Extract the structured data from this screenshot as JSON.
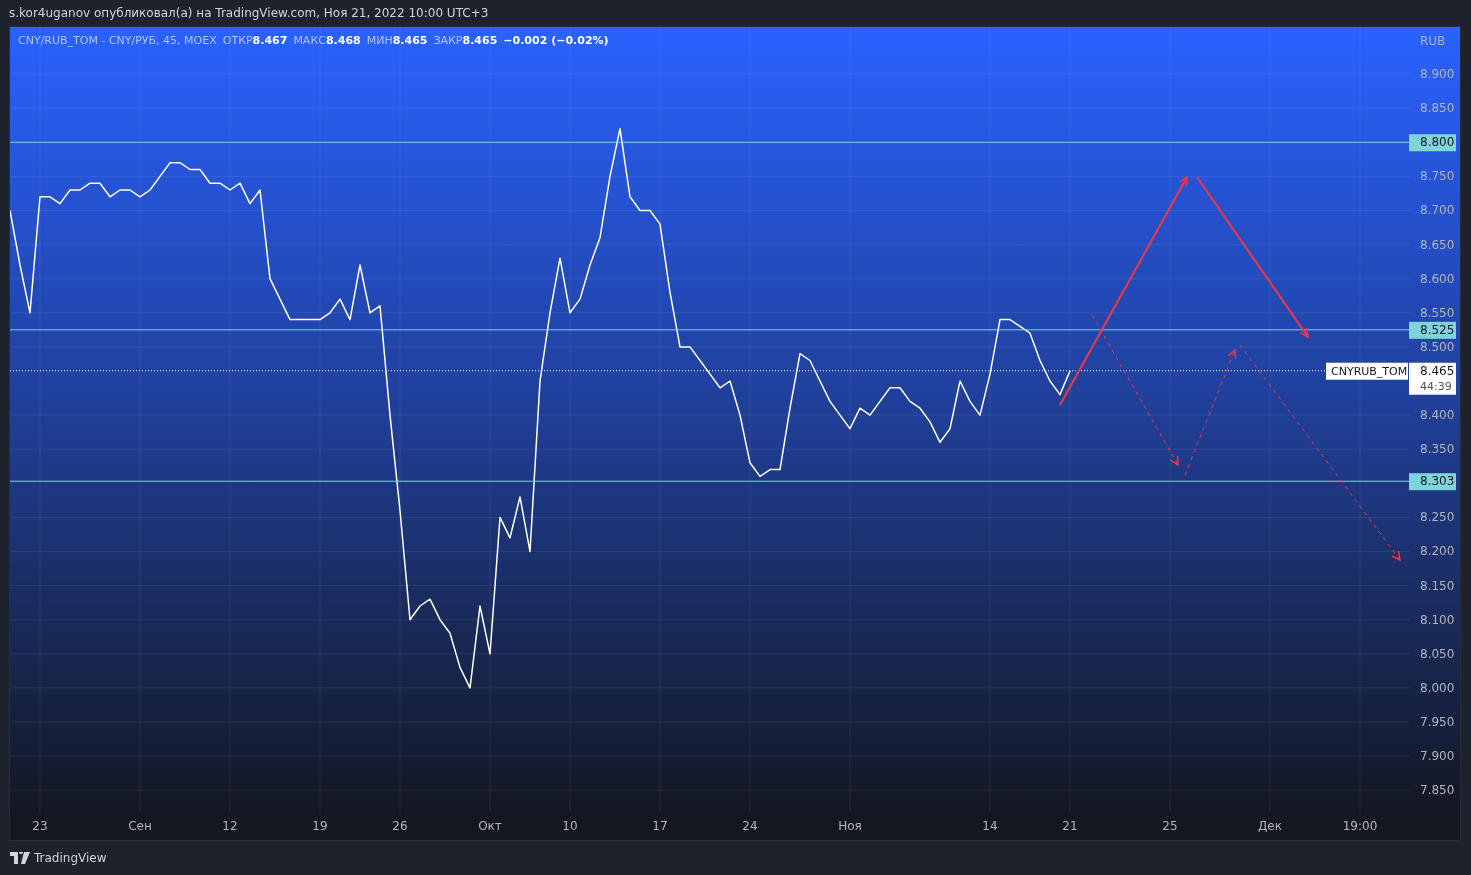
{
  "header": {
    "text": "s.kor4uganov опубликовал(а) на TradingView.com, Ноя 21, 2022 10:00 UTC+3"
  },
  "legend": {
    "symbol": "CNY/RUB_TOM - CNY/РУБ, 45, MOEX",
    "fields": [
      {
        "label": "ОТКР",
        "value": "8.467"
      },
      {
        "label": "МАКС",
        "value": "8.468"
      },
      {
        "label": "МИН",
        "value": "8.465"
      },
      {
        "label": "ЗАКР",
        "value": "8.465"
      }
    ],
    "change": "−0.002 (−0.02%)"
  },
  "chart": {
    "chart_data": {
      "type": "line",
      "ylabel": "RUB",
      "ylim": [
        7.818,
        8.969
      ],
      "categories": [
        null,
        null,
        null,
        "23",
        null,
        null,
        null,
        null,
        null,
        null,
        null,
        null,
        null,
        "Сен",
        null,
        null,
        null,
        null,
        null,
        null,
        null,
        null,
        "12",
        null,
        null,
        null,
        null,
        null,
        null,
        null,
        null,
        "19",
        null,
        null,
        null,
        null,
        null,
        null,
        null,
        "26",
        null,
        null,
        null,
        null,
        null,
        null,
        null,
        null,
        "Окт",
        null,
        null,
        null,
        null,
        null,
        null,
        null,
        "10",
        null,
        null,
        null,
        null,
        null,
        null,
        null,
        null,
        "17",
        null,
        null,
        null,
        null,
        null,
        null,
        null,
        null,
        "24",
        null,
        null,
        null,
        null,
        null,
        null,
        null,
        null,
        null,
        "Ноя",
        null,
        null,
        null,
        null,
        null,
        null,
        null,
        null,
        null,
        null,
        null,
        null,
        null,
        "14",
        null,
        null,
        null,
        null,
        null,
        null,
        null,
        "21",
        null,
        null,
        null,
        null,
        null,
        null,
        null,
        null,
        null,
        "25",
        null,
        null,
        null,
        null,
        null,
        null,
        null,
        null,
        null,
        "Дек",
        null,
        null,
        null,
        null,
        null,
        null,
        null,
        null,
        "19:00",
        null,
        null,
        null,
        null,
        null
      ],
      "series": [
        {
          "name": "CNYRUB_TOM",
          "color": "#ffffff",
          "values": [
            8.7,
            8.62,
            8.55,
            8.72,
            8.72,
            8.71,
            8.73,
            8.73,
            8.74,
            8.74,
            8.72,
            8.73,
            8.73,
            8.72,
            8.73,
            8.75,
            8.77,
            8.77,
            8.76,
            8.76,
            8.74,
            8.74,
            8.73,
            8.74,
            8.71,
            8.73,
            8.6,
            8.57,
            8.54,
            8.54,
            8.54,
            8.54,
            8.55,
            8.57,
            8.54,
            8.62,
            8.55,
            8.56,
            8.4,
            8.26,
            8.1,
            8.12,
            8.13,
            8.1,
            8.08,
            8.03,
            8.0,
            8.12,
            8.05,
            8.25,
            8.22,
            8.28,
            8.2,
            8.45,
            8.55,
            8.63,
            8.55,
            8.57,
            8.62,
            8.66,
            8.75,
            8.82,
            8.72,
            8.7,
            8.7,
            8.68,
            8.58,
            8.5,
            8.5,
            8.48,
            8.46,
            8.44,
            8.45,
            8.4,
            8.33,
            8.31,
            8.32,
            8.32,
            8.41,
            8.49,
            8.48,
            8.45,
            8.42,
            8.4,
            8.38,
            8.41,
            8.4,
            8.42,
            8.44,
            8.44,
            8.42,
            8.41,
            8.39,
            8.36,
            8.38,
            8.45,
            8.42,
            8.4,
            8.46,
            8.54,
            8.54,
            8.53,
            8.52,
            8.48,
            8.45,
            8.43,
            8.465,
            null,
            null,
            null,
            null,
            null,
            null,
            null,
            null,
            null,
            null,
            null,
            null,
            null,
            null,
            null,
            null,
            null,
            null,
            null,
            null,
            null,
            null,
            null,
            null,
            null,
            null,
            null,
            null,
            null,
            null,
            null,
            null,
            null,
            null
          ]
        }
      ],
      "yticks": [
        {
          "value": 7.85,
          "label": "7.850"
        },
        {
          "value": 7.9,
          "label": "7.900"
        },
        {
          "value": 7.95,
          "label": "7.950"
        },
        {
          "value": 8.0,
          "label": "8.000"
        },
        {
          "value": 8.05,
          "label": "8.050"
        },
        {
          "value": 8.1,
          "label": "8.100"
        },
        {
          "value": 8.15,
          "label": "8.150"
        },
        {
          "value": 8.2,
          "label": "8.200"
        },
        {
          "value": 8.25,
          "label": "8.250"
        },
        {
          "value": 8.35,
          "label": "8.350"
        },
        {
          "value": 8.4,
          "label": "8.400"
        },
        {
          "value": 8.5,
          "label": "8.500"
        },
        {
          "value": 8.55,
          "label": "8.550"
        },
        {
          "value": 8.6,
          "label": "8.600"
        },
        {
          "value": 8.65,
          "label": "8.650"
        },
        {
          "value": 8.7,
          "label": "8.700"
        },
        {
          "value": 8.75,
          "label": "8.750"
        },
        {
          "value": 8.85,
          "label": "8.850"
        },
        {
          "value": 8.9,
          "label": "8.900"
        }
      ],
      "grid": true,
      "ref_lines": [
        {
          "axis": "y",
          "value": 8.8,
          "label": "8.800",
          "color": "#7fd4dc"
        },
        {
          "axis": "y",
          "value": 8.525,
          "label": "8.525",
          "color": "#7fd4dc"
        },
        {
          "axis": "y",
          "value": 8.303,
          "label": "8.303",
          "color": "#7fd4dc"
        }
      ]
    },
    "price_marker": {
      "price": "8.465",
      "countdown": "44:39"
    }
  },
  "footer": {
    "brand": "TradingView"
  }
}
